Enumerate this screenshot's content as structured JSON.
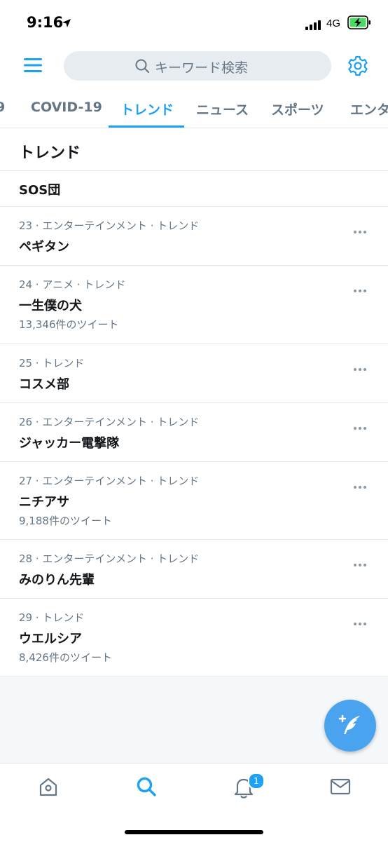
{
  "status_bar": {
    "time": "9:16",
    "network": "4G"
  },
  "header": {
    "search_placeholder": "キーワード検索"
  },
  "tabs": [
    {
      "label": "COVID-19"
    },
    {
      "label": "トレンド",
      "active": true
    },
    {
      "label": "ニュース"
    },
    {
      "label": "スポーツ"
    },
    {
      "label": "エンタ"
    }
  ],
  "section": {
    "title": "トレンド"
  },
  "trends": [
    {
      "meta": "",
      "name": "SOS団",
      "count": ""
    },
    {
      "meta": "23 · エンターテインメント · トレンド",
      "name": "ペギタン",
      "count": ""
    },
    {
      "meta": "24 · アニメ · トレンド",
      "name": "一生僕の犬",
      "count": "13,346件のツイート"
    },
    {
      "meta": "25 · トレンド",
      "name": "コスメ部",
      "count": ""
    },
    {
      "meta": "26 · エンターテインメント · トレンド",
      "name": "ジャッカー電撃隊",
      "count": ""
    },
    {
      "meta": "27 · エンターテインメント · トレンド",
      "name": "ニチアサ",
      "count": "9,188件のツイート"
    },
    {
      "meta": "28 · エンターテインメント · トレンド",
      "name": "みのりん先輩",
      "count": ""
    },
    {
      "meta": "29 · トレンド",
      "name": "ウエルシア",
      "count": "8,426件のツイート"
    }
  ],
  "bottom_nav": {
    "notification_badge": "1",
    "items": [
      "home-icon",
      "search-icon",
      "bell-icon",
      "mail-icon"
    ]
  },
  "colors": {
    "accent": "#1da1f2",
    "text_primary": "#14171a",
    "text_secondary": "#657786",
    "divider": "#e1e8ed",
    "fab": "#4aa3ee"
  }
}
